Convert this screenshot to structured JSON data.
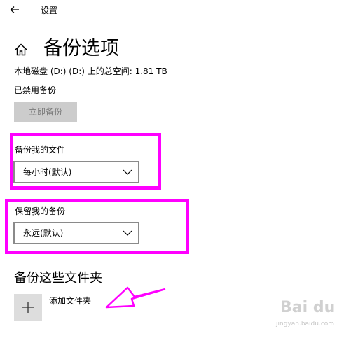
{
  "titlebar": {
    "back_icon": "back-arrow-icon",
    "title": "设置"
  },
  "header": {
    "home_icon": "home-icon",
    "title": "备份选项"
  },
  "disk_info": "本地磁盘 (D:) (D:) 上的总空间: 1.81 TB",
  "backup_status": "已禁用备份",
  "backup_now_label": "立即备份",
  "frequency": {
    "label": "备份我的文件",
    "value": "每小时(默认)"
  },
  "retention": {
    "label": "保留我的备份",
    "value": "永远(默认)"
  },
  "folders_section": {
    "heading": "备份这些文件夹",
    "add_icon": "plus-icon",
    "add_label": "添加文件夹"
  },
  "annotation_color": "#ff00ff",
  "watermark": {
    "text": "Bai du",
    "sub": "jingyan.baidu.com"
  }
}
